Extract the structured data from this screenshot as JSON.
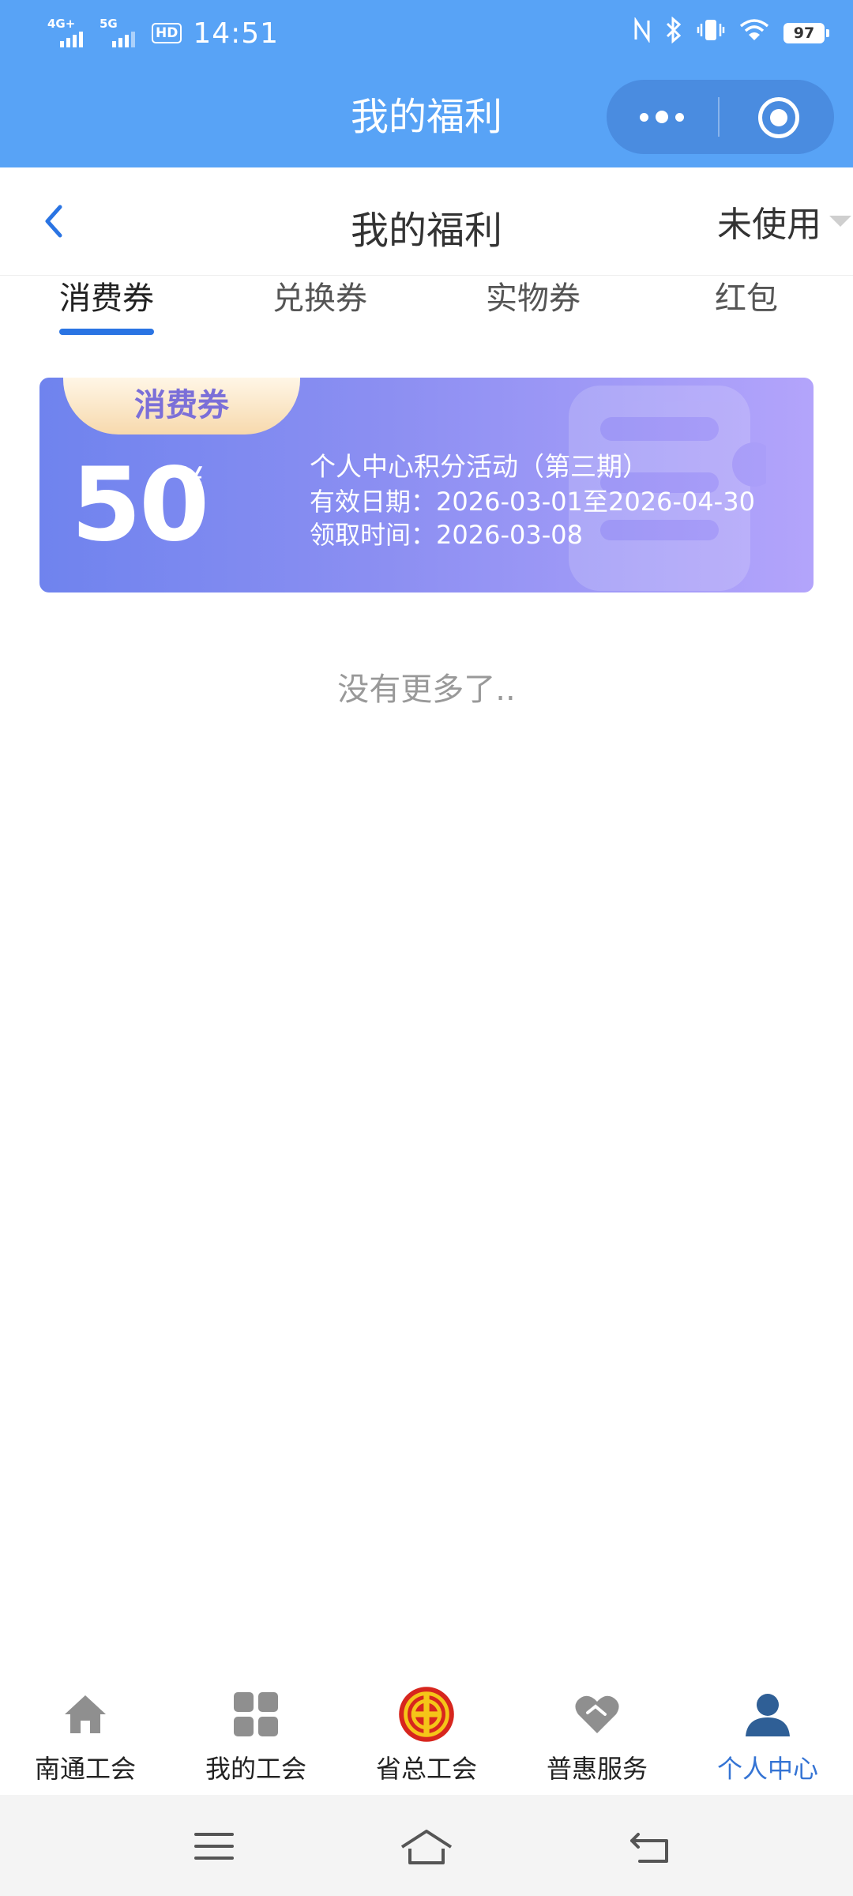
{
  "status_bar": {
    "network_1": "4G+",
    "network_2": "5G",
    "hd_label": "HD",
    "time": "14:51",
    "battery": "97"
  },
  "mini_program": {
    "title": "我的福利"
  },
  "navbar": {
    "title": "我的福利",
    "filter_label": "未使用"
  },
  "tabs": [
    {
      "label": "消费券",
      "active": true
    },
    {
      "label": "兑换券",
      "active": false
    },
    {
      "label": "实物券",
      "active": false
    },
    {
      "label": "红包",
      "active": false
    }
  ],
  "coupon": {
    "tag": "消费券",
    "amount": "50",
    "currency": "¥",
    "title": "个人中心积分活动（第三期）",
    "valid_period": "有效日期：2026-03-01至2026-04-30",
    "claim_time": "领取时间：2026-03-08"
  },
  "list_end_text": "没有更多了..",
  "bottom_tabs": [
    {
      "label": "南通工会",
      "icon": "home-icon"
    },
    {
      "label": "我的工会",
      "icon": "grid-icon"
    },
    {
      "label": "省总工会",
      "icon": "union-emblem-icon"
    },
    {
      "label": "普惠服务",
      "icon": "heart-icon"
    },
    {
      "label": "个人中心",
      "icon": "person-icon",
      "active": true
    }
  ],
  "colors": {
    "header_blue": "#58a3f6",
    "tab_indicator": "#2a74e3",
    "active_tab_label": "#3574d4",
    "coupon_gradient_start": "#6f83ee",
    "coupon_gradient_end": "#b3a4fb"
  }
}
